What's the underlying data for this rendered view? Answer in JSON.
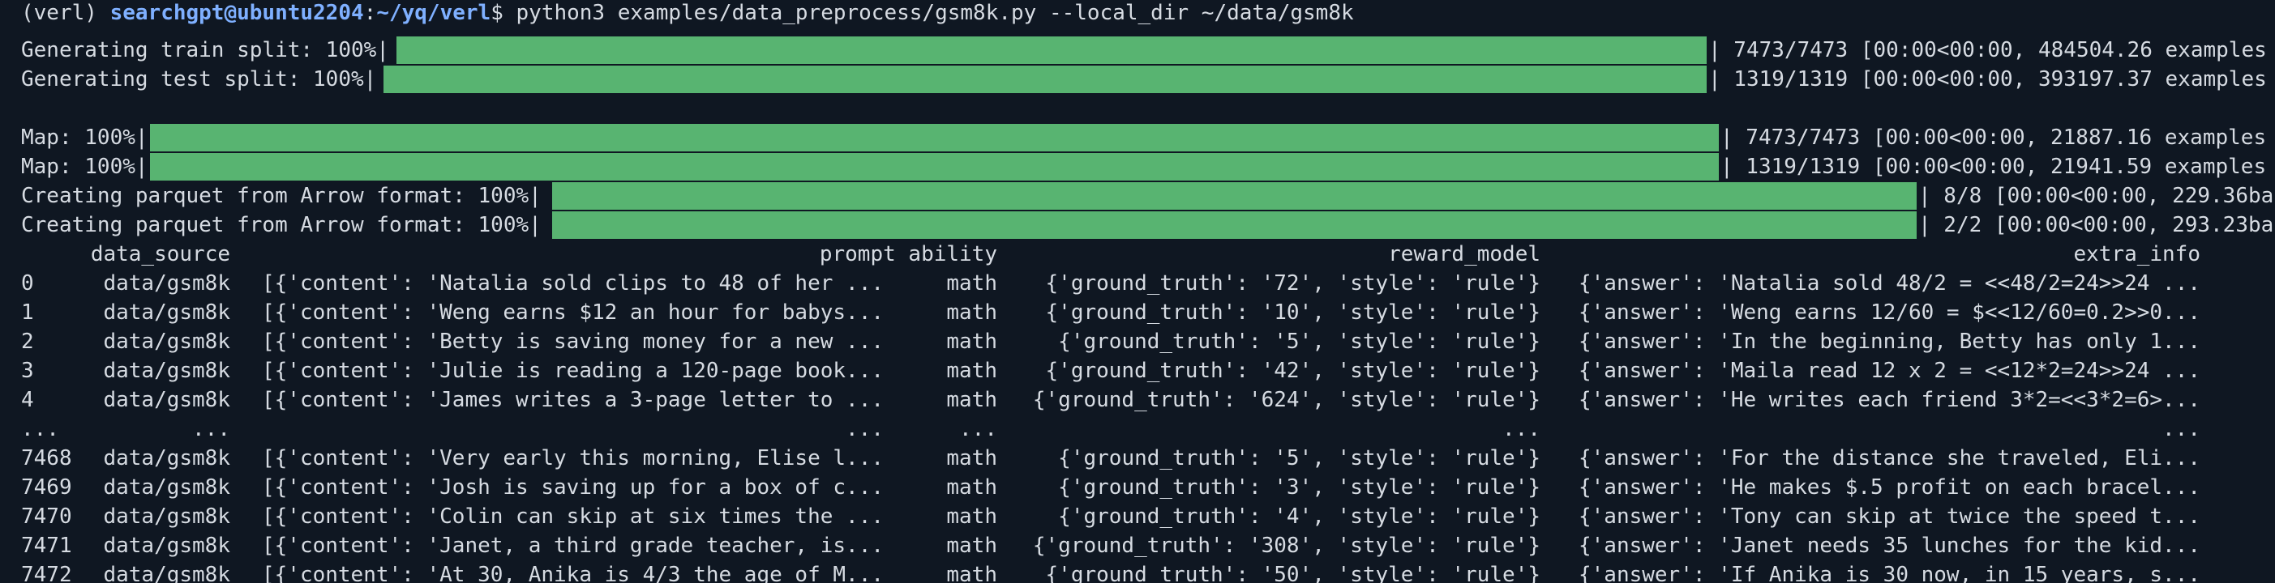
{
  "colors": {
    "background": "#0f1722",
    "text": "#d6dbe2",
    "prompt": "#7fb0ff",
    "progress_fill": "#58b471"
  },
  "prompt": {
    "env": "(verl) ",
    "userhost": "searchgpt@ubuntu2204",
    "sep": ":",
    "path": "~/yq/verl",
    "dollar": "$ ",
    "command": "python3 examples/data_preprocess/gsm8k.py --local_dir ~/data/gsm8k"
  },
  "progress": [
    {
      "label": "Generating train split: 100%|",
      "stats": "| 7473/7473 [00:00<00:00, 484504.26 examples",
      "percent": 100
    },
    {
      "label": "Generating test split: 100%|",
      "stats": "| 1319/1319 [00:00<00:00, 393197.37 examples",
      "percent": 100
    },
    {
      "label": "Map: 100%|",
      "stats": "| 7473/7473 [00:00<00:00, 21887.16 examples",
      "percent": 100
    },
    {
      "label": "Map: 100%|",
      "stats": "| 1319/1319 [00:00<00:00, 21941.59 examples",
      "percent": 100
    },
    {
      "label": "Creating parquet from Arrow format: 100%|",
      "stats": "| 8/8 [00:00<00:00, 229.36ba",
      "percent": 100
    },
    {
      "label": "Creating parquet from Arrow format: 100%|",
      "stats": "| 2/2 [00:00<00:00, 293.23ba",
      "percent": 100
    }
  ],
  "table": {
    "headers": [
      "data_source",
      "prompt ability",
      "reward_model",
      "extra_info"
    ],
    "rows": [
      [
        "0",
        "data/gsm8k",
        "[{'content': 'Natalia sold clips to 48 of her ...",
        "math",
        "{'ground_truth': '72', 'style': 'rule'}",
        "{'answer': 'Natalia sold 48/2 = <<48/2=24>>24 ..."
      ],
      [
        "1",
        "data/gsm8k",
        "[{'content': 'Weng earns $12 an hour for babys...",
        "math",
        "{'ground_truth': '10', 'style': 'rule'}",
        "{'answer': 'Weng earns 12/60 = $<<12/60=0.2>>0..."
      ],
      [
        "2",
        "data/gsm8k",
        "[{'content': 'Betty is saving money for a new ...",
        "math",
        "{'ground_truth': '5', 'style': 'rule'}",
        "{'answer': 'In the beginning, Betty has only 1..."
      ],
      [
        "3",
        "data/gsm8k",
        "[{'content': 'Julie is reading a 120-page book...",
        "math",
        "{'ground_truth': '42', 'style': 'rule'}",
        "{'answer': 'Maila read 12 x 2 = <<12*2=24>>24 ..."
      ],
      [
        "4",
        "data/gsm8k",
        "[{'content': 'James writes a 3-page letter to ...",
        "math",
        "{'ground_truth': '624', 'style': 'rule'}",
        "{'answer': 'He writes each friend 3*2=<<3*2=6>..."
      ],
      [
        "...",
        "...",
        "...",
        "...",
        "...",
        "..."
      ],
      [
        "7468",
        "data/gsm8k",
        "[{'content': 'Very early this morning, Elise l...",
        "math",
        "{'ground_truth': '5', 'style': 'rule'}",
        "{'answer': 'For the distance she traveled, Eli..."
      ],
      [
        "7469",
        "data/gsm8k",
        "[{'content': 'Josh is saving up for a box of c...",
        "math",
        "{'ground_truth': '3', 'style': 'rule'}",
        "{'answer': 'He makes $.5 profit on each bracel..."
      ],
      [
        "7470",
        "data/gsm8k",
        "[{'content': 'Colin can skip at six times the ...",
        "math",
        "{'ground_truth': '4', 'style': 'rule'}",
        "{'answer': 'Tony can skip at twice the speed t..."
      ],
      [
        "7471",
        "data/gsm8k",
        "[{'content': 'Janet, a third grade teacher, is...",
        "math",
        "{'ground_truth': '308', 'style': 'rule'}",
        "{'answer': 'Janet needs 35 lunches for the kid..."
      ],
      [
        "7472",
        "data/gsm8k",
        "[{'content': 'At 30, Anika is 4/3 the age of M...",
        "math",
        "{'ground_truth': '50', 'style': 'rule'}",
        "{'answer': 'If Anika is 30 now, in 15 years, s..."
      ]
    ]
  }
}
